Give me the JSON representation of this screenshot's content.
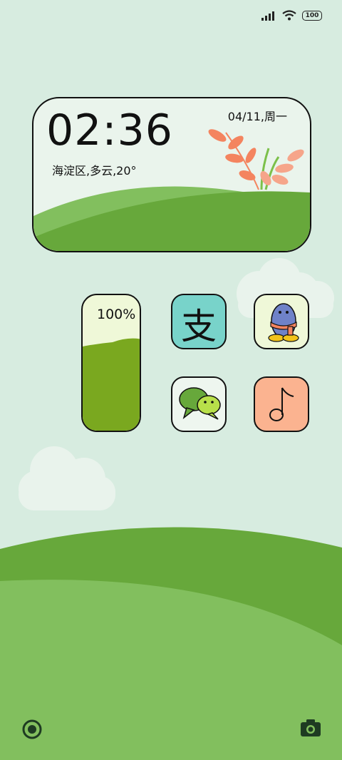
{
  "status_bar": {
    "battery": "100",
    "signal_icon": "signal-icon",
    "wifi_icon": "wifi-icon"
  },
  "clock_widget": {
    "time": "02:36",
    "date": "04/11,周一",
    "weather": "海淀区,多云,20°"
  },
  "battery_widget": {
    "percent_label": "100%",
    "level": 0.6
  },
  "apps": [
    {
      "name": "alipay",
      "glyph": "支",
      "bg": "#78d3ca"
    },
    {
      "name": "qq",
      "bg": "#eff8d8"
    },
    {
      "name": "wechat",
      "bg": "#eef6ef"
    },
    {
      "name": "douyin",
      "bg": "#fbb390"
    }
  ],
  "colors": {
    "background": "#d7ece0",
    "grass_dark": "#67a83b",
    "grass_light": "#82bf5e",
    "accent_orange": "#f4845f"
  },
  "dock": {
    "left_icon": "circle-record-icon",
    "right_icon": "camera-icon"
  }
}
